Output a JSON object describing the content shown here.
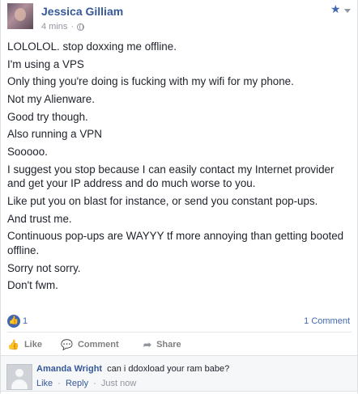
{
  "post": {
    "author": "Jessica Gilliam",
    "time": "4 mins",
    "separator": "·",
    "paragraphs": [
      "LOLOLOL. stop doxxing me offline.",
      "I'm using a VPS",
      "Only thing you're doing is fucking with my wifi for my phone.",
      "Not my Alienware.",
      "Good try though.",
      "Also running a VPN",
      "Sooooo.",
      "I suggest you stop because I can easily contact my Internet provider and get your IP address and do much worse to you.",
      "Like put you on blast for instance, or send you constant pop-ups.",
      "And trust me.",
      "Continuous pop-ups are WAYYY tf more annoying than getting booted offline.",
      "Sorry not sorry.",
      "Don't fwm."
    ]
  },
  "reactions": {
    "like_count": "1",
    "comment_count": "1 Comment"
  },
  "actions": {
    "like": "Like",
    "comment": "Comment",
    "share": "Share"
  },
  "comment": {
    "author": "Amanda Wright",
    "text": "can i ddoxload your ram babe?",
    "like": "Like",
    "reply": "Reply",
    "time": "Just now",
    "separator": "·"
  },
  "icons": {
    "star": "star-icon",
    "menu": "chevron-down-icon",
    "privacy": "globe-icon",
    "reaction": "thumbs-up-icon"
  },
  "colors": {
    "link": "#365899",
    "accent": "#4267b2",
    "muted": "#90949c",
    "background": "#e9ebee"
  }
}
